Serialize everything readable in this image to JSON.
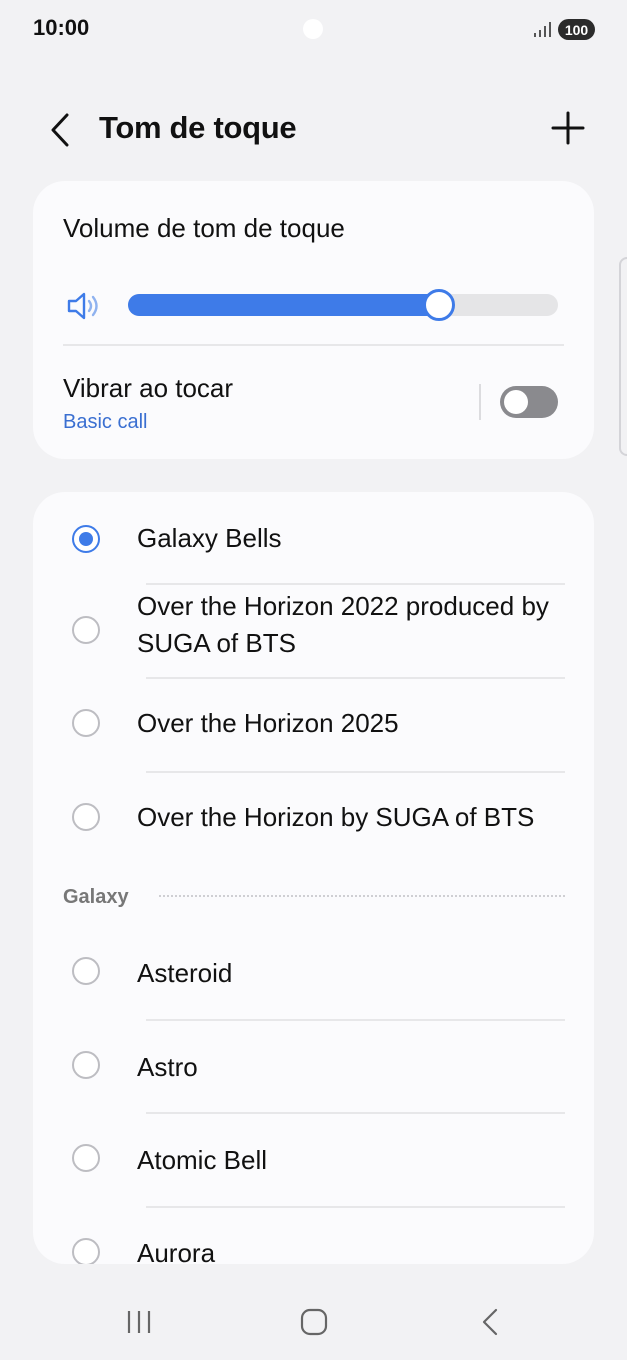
{
  "status_bar": {
    "time": "10:00",
    "battery": "100"
  },
  "header": {
    "title": "Tom de toque"
  },
  "volume_card": {
    "title": "Volume de tom de toque",
    "volume_level_fraction": 0.72,
    "vibrate_label": "Vibrar ao tocar",
    "vibrate_pattern": "Basic call",
    "vibrate_on": false
  },
  "ringtones": {
    "top_items": [
      {
        "label": "Galaxy Bells",
        "selected": true
      },
      {
        "label": "Over the Horizon 2022 produced by SUGA of BTS",
        "selected": false
      },
      {
        "label": "Over the Horizon 2025",
        "selected": false
      },
      {
        "label": "Over the Horizon by SUGA of BTS",
        "selected": false
      }
    ],
    "section_label": "Galaxy",
    "galaxy_items": [
      {
        "label": "Asteroid",
        "selected": false
      },
      {
        "label": "Astro",
        "selected": false
      },
      {
        "label": "Atomic Bell",
        "selected": false
      },
      {
        "label": "Aurora",
        "selected": false
      }
    ]
  },
  "colors": {
    "accent": "#3e7be8",
    "background": "#f2f2f4",
    "card": "#fbfbfd"
  }
}
